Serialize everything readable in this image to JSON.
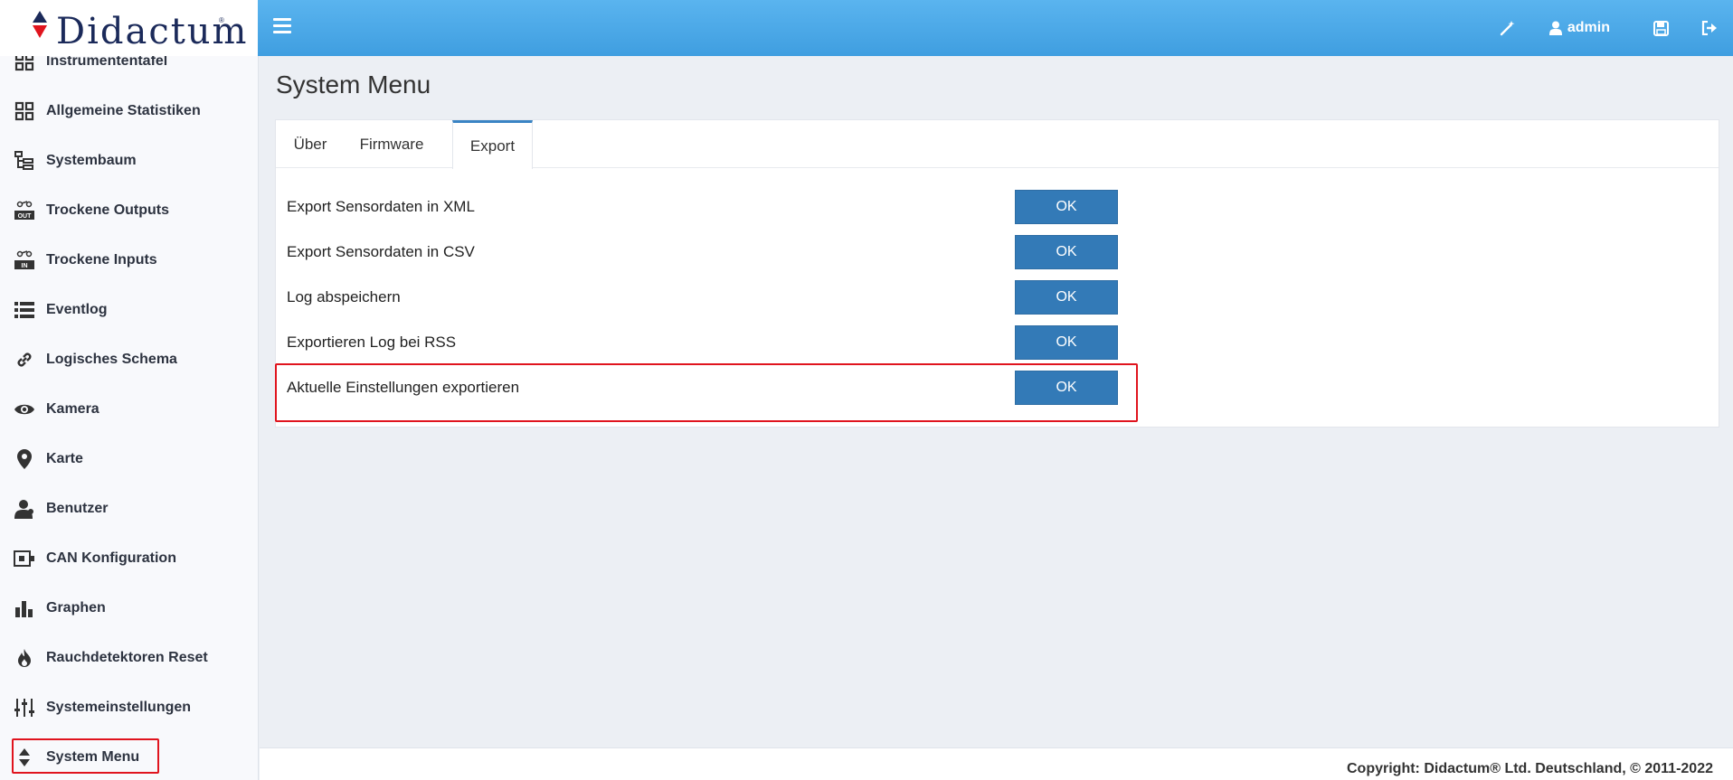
{
  "brand": {
    "name": "Didactum",
    "reg_mark": "®"
  },
  "header": {
    "user_label": "admin",
    "icons": [
      "menu-icon",
      "wand-icon",
      "user-icon",
      "save-icon",
      "logout-icon"
    ]
  },
  "sidebar": {
    "items": [
      {
        "label": "Instrumententafel",
        "icon": "dashboard-grid-icon"
      },
      {
        "label": "Allgemeine Statistiken",
        "icon": "statistics-grid-icon"
      },
      {
        "label": "Systembaum",
        "icon": "tree-icon"
      },
      {
        "label": "Trockene Outputs",
        "icon": "dry-output-icon"
      },
      {
        "label": "Trockene Inputs",
        "icon": "dry-input-icon"
      },
      {
        "label": "Eventlog",
        "icon": "list-icon"
      },
      {
        "label": "Logisches Schema",
        "icon": "link-icon"
      },
      {
        "label": "Kamera",
        "icon": "eye-icon"
      },
      {
        "label": "Karte",
        "icon": "map-marker-icon"
      },
      {
        "label": "Benutzer",
        "icon": "users-icon"
      },
      {
        "label": "CAN Konfiguration",
        "icon": "can-icon"
      },
      {
        "label": "Graphen",
        "icon": "bar-chart-icon"
      },
      {
        "label": "Rauchdetektoren Reset",
        "icon": "fire-icon"
      },
      {
        "label": "Systemeinstellungen",
        "icon": "sliders-icon"
      },
      {
        "label": "System Menu",
        "icon": "sort-icon",
        "active": true
      }
    ]
  },
  "main": {
    "title": "System Menu",
    "tabs": [
      {
        "label": "Über"
      },
      {
        "label": "Firmware"
      },
      {
        "label": "Export",
        "active": true
      }
    ],
    "export_rows": [
      {
        "label": "Export Sensordaten in XML",
        "button": "OK"
      },
      {
        "label": "Export Sensordaten in CSV",
        "button": "OK"
      },
      {
        "label": "Log abspeichern",
        "button": "OK"
      },
      {
        "label": "Exportieren Log bei RSS",
        "button": "OK"
      },
      {
        "label": "Aktuelle Einstellungen exportieren",
        "button": "OK"
      }
    ]
  },
  "footer": {
    "copyright": "Copyright: Didactum® Ltd. Deutschland, © 2011-2022"
  },
  "colors": {
    "header": "#4aa8ea",
    "button": "#337ab7",
    "highlight": "#e0141e",
    "tab_active": "#3a84c4"
  }
}
